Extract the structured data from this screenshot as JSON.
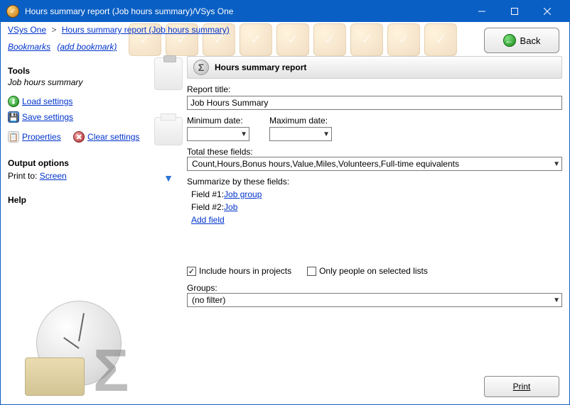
{
  "window": {
    "title": "Hours summary report (Job hours summary)/VSys One"
  },
  "breadcrumb": {
    "root": "VSys One",
    "current": "Hours summary report (Job hours summary)"
  },
  "bookmarks": {
    "label": "Bookmarks",
    "add_label": "(add bookmark)"
  },
  "back_button": "Back",
  "sidebar": {
    "tools_title": "Tools",
    "tools_subtitle": "Job hours summary",
    "load_settings": "Load settings",
    "save_settings": "Save settings",
    "properties": "Properties",
    "clear_settings": "Clear settings",
    "output_title": "Output options",
    "print_to_label": "Print to:",
    "print_to_value": "Screen",
    "help_title": "Help"
  },
  "report": {
    "header": "Hours summary report",
    "title_label": "Report title:",
    "title_value": "Job Hours Summary",
    "min_date_label": "Minimum date:",
    "min_date_value": "",
    "max_date_label": "Maximum date:",
    "max_date_value": "",
    "total_fields_label": "Total these fields:",
    "total_fields_value": "Count,Hours,Bonus hours,Value,Miles,Volunteers,Full-time equivalents",
    "summarize_label": "Summarize by these fields:",
    "field1_label": "Field #1:",
    "field1_value": "Job group",
    "field2_label": "Field #2:",
    "field2_value": "Job",
    "add_field": "Add field",
    "include_hours_label": "Include hours in projects",
    "include_hours_checked": true,
    "only_selected_label": "Only people on selected lists",
    "only_selected_checked": false,
    "groups_label": "Groups:",
    "groups_value": "(no filter)"
  },
  "print_button": "Print"
}
